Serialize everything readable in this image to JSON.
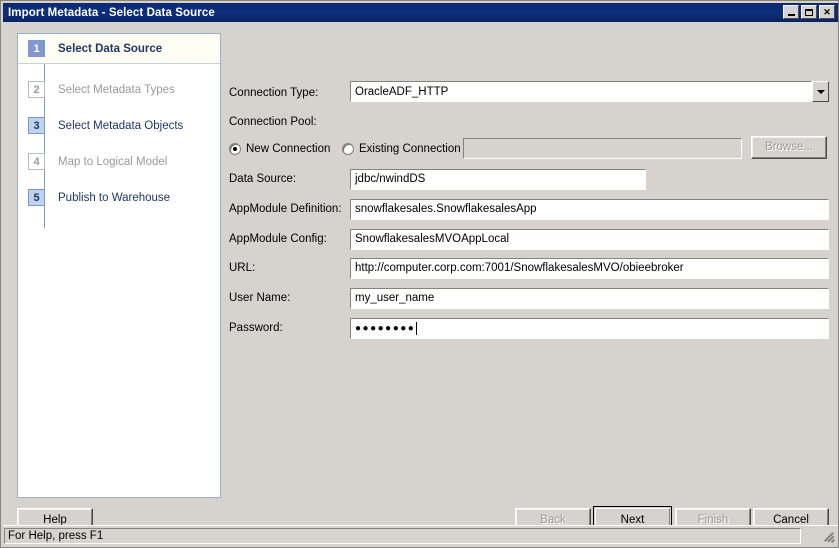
{
  "window": {
    "title": "Import Metadata - Select Data Source",
    "controls": {
      "minimize": "minimize-icon",
      "maximize": "maximize-icon",
      "close": "✕"
    }
  },
  "sidebar": {
    "steps": [
      {
        "number": "1",
        "label": "Select Data Source",
        "state": "active"
      },
      {
        "number": "2",
        "label": "Select Metadata Types",
        "state": "disabled"
      },
      {
        "number": "3",
        "label": "Select Metadata Objects",
        "state": "enabled"
      },
      {
        "number": "4",
        "label": "Map to Logical Model",
        "state": "disabled"
      },
      {
        "number": "5",
        "label": "Publish to Warehouse",
        "state": "enabled"
      }
    ]
  },
  "form": {
    "connection_type": {
      "label": "Connection Type:",
      "value": "OracleADF_HTTP",
      "options": [
        "OracleADF_HTTP"
      ]
    },
    "connection_pool": {
      "label": "Connection Pool:"
    },
    "new_connection": {
      "label": "New Connection",
      "selected": true
    },
    "existing_connection": {
      "label": "Existing Connection",
      "selected": false,
      "value": "",
      "enabled": false
    },
    "browse": {
      "label": "Browse...",
      "enabled": false
    },
    "data_source": {
      "label": "Data Source:",
      "value": "jdbc/nwindDS"
    },
    "appmodule_definition": {
      "label": "AppModule Definition:",
      "value": "snowflakesales.SnowflakesalesApp"
    },
    "appmodule_config": {
      "label": "AppModule Config:",
      "value": "SnowflakesalesMVOAppLocal"
    },
    "url": {
      "label": "URL:",
      "value": "http://computer.corp.com:7001/SnowflakesalesMVO/obieebroker"
    },
    "user_name": {
      "label": "User Name:",
      "value": "my_user_name"
    },
    "password": {
      "label": "Password:",
      "value": "●●●●●●●●",
      "masked": true
    }
  },
  "buttons": {
    "help": {
      "label": "Help",
      "enabled": true
    },
    "back": {
      "label": "Back",
      "enabled": false
    },
    "next": {
      "label": "Next",
      "enabled": true,
      "default": true
    },
    "finish": {
      "label": "Finish",
      "enabled": false
    },
    "cancel": {
      "label": "Cancel",
      "enabled": true
    }
  },
  "statusbar": {
    "text": "For Help, press F1"
  },
  "colors": {
    "titlebar": "#0e2f7e",
    "dialog_face": "#d6d3ce",
    "step_active": "#8097d0",
    "step_enabled": "#bdd3ef",
    "step_text": "#1f3864",
    "disabled_text": "#9a9a9a"
  }
}
